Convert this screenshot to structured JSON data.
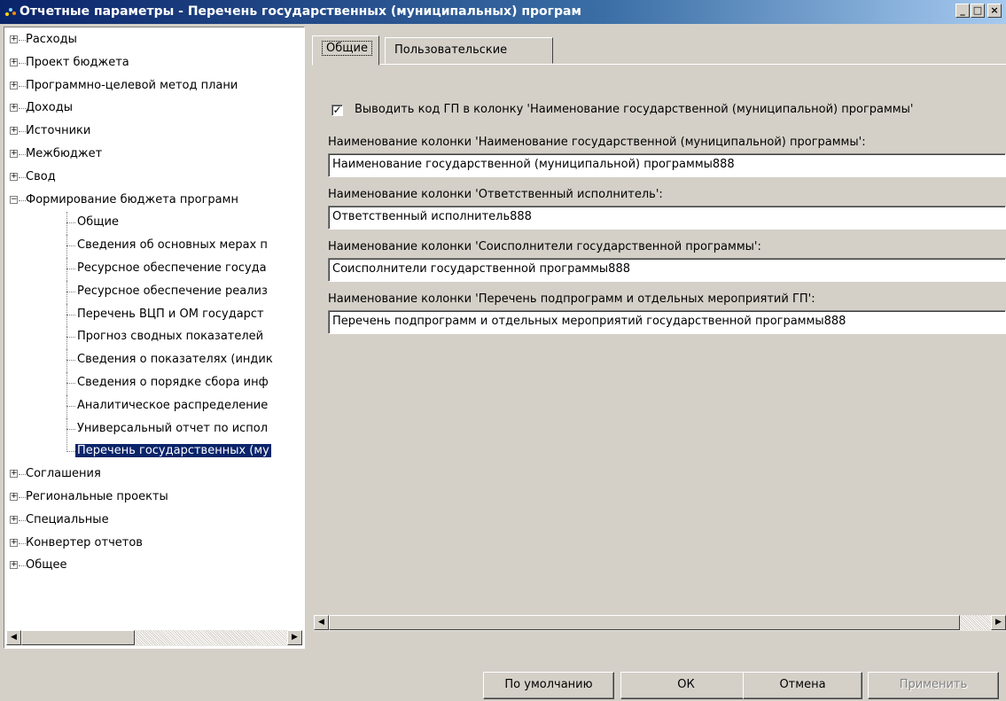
{
  "window": {
    "title": "Отчетные параметры - Перечень государственных (муниципальных) програм",
    "min_glyph": "_",
    "max_glyph": "□",
    "close_glyph": "×"
  },
  "tree": {
    "items_before": [
      {
        "label": "Расходы",
        "expander": "+"
      },
      {
        "label": "Проект бюджета",
        "expander": "+"
      },
      {
        "label": "Программно-целевой метод плани",
        "expander": "+"
      },
      {
        "label": "Доходы",
        "expander": "+"
      },
      {
        "label": "Источники",
        "expander": "+"
      },
      {
        "label": "Межбюджет",
        "expander": "+"
      },
      {
        "label": "Свод",
        "expander": "+"
      },
      {
        "label": "Формирование бюджета програмн",
        "expander": "−"
      }
    ],
    "children": [
      {
        "label": "Общие"
      },
      {
        "label": "Сведения об основных мерах п"
      },
      {
        "label": "Ресурсное обеспечение госуда"
      },
      {
        "label": "Ресурсное обеспечение реализ"
      },
      {
        "label": "Перечень ВЦП и ОМ государст"
      },
      {
        "label": "Прогноз сводных показателей"
      },
      {
        "label": "Сведения о показателях (индик"
      },
      {
        "label": "Сведения о порядке сбора инф"
      },
      {
        "label": "Аналитическое распределение"
      },
      {
        "label": "Универсальный отчет по испол"
      },
      {
        "label": "Перечень государственных (му",
        "selected": true
      }
    ],
    "items_after": [
      {
        "label": "Соглашения",
        "expander": "+"
      },
      {
        "label": "Региональные проекты",
        "expander": "+"
      },
      {
        "label": "Специальные",
        "expander": "+"
      },
      {
        "label": "Конвертер отчетов",
        "expander": "+"
      },
      {
        "label": "Общее",
        "expander": "+"
      }
    ]
  },
  "tabs": {
    "general": "Общие",
    "custom": "Пользовательские"
  },
  "general": {
    "checkbox_label": "Выводить код ГП в колонку 'Наименование государственной (муниципальной) программы'",
    "checkbox_checked": true,
    "check_glyph": "✓",
    "fields": [
      {
        "label": "Наименование колонки 'Наименование государственной (муниципальной) программы':",
        "value": "Наименование государственной (муниципальной) программы888"
      },
      {
        "label": "Наименование колонки 'Ответственный исполнитель':",
        "value": "Ответственный исполнитель888"
      },
      {
        "label": "Наименование колонки 'Соисполнители государственной программы':",
        "value": "Соисполнители государственной программы888"
      },
      {
        "label": "Наименование колонки 'Перечень подпрограмм и отдельных мероприятий ГП':",
        "value": "Перечень подпрограмм и отдельных мероприятий государственной программы888"
      }
    ]
  },
  "scroll": {
    "left_glyph": "◀",
    "right_glyph": "▶"
  },
  "buttons": {
    "default": "По умолчанию",
    "ok": "ОК",
    "cancel": "Отмена",
    "apply": "Применить"
  }
}
